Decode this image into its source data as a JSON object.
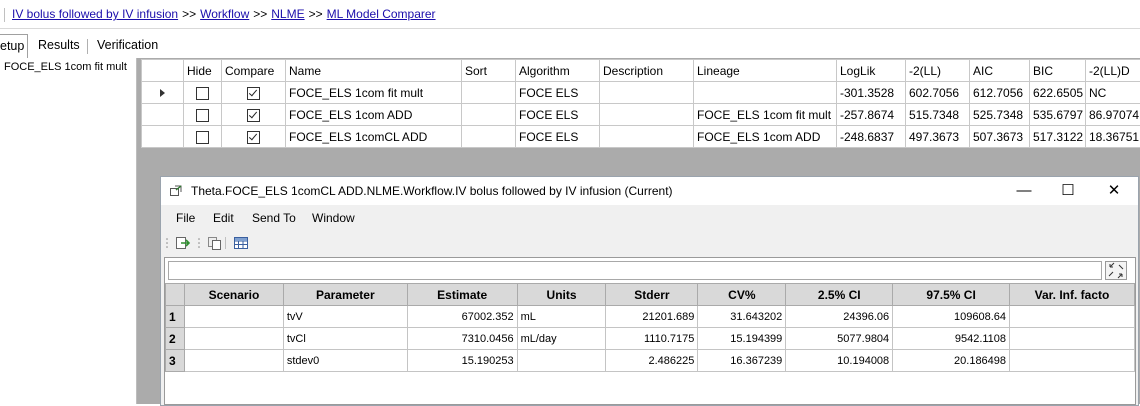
{
  "breadcrumbs": {
    "items": [
      "IV bolus followed by IV infusion",
      "Workflow",
      "NLME",
      "ML Model Comparer"
    ],
    "separator": ">>"
  },
  "tabs": [
    {
      "label": "etup"
    },
    {
      "label": "Results"
    },
    {
      "label": "Verification"
    }
  ],
  "left_pane": {
    "item": "FOCE_ELS 1com fit mult"
  },
  "model_table": {
    "columns": [
      "Hide",
      "Compare",
      "Name",
      "Sort",
      "Algorithm",
      "Description",
      "Lineage",
      "LogLik",
      "-2(LL)",
      "AIC",
      "BIC",
      "-2(LL)D"
    ],
    "rows": [
      {
        "current": true,
        "hide": false,
        "compare": true,
        "name": "FOCE_ELS 1com fit mult",
        "sort": "",
        "algorithm": "FOCE ELS",
        "description": "",
        "lineage": "",
        "loglik": "-301.3528",
        "m2ll": "602.7056",
        "aic": "612.7056",
        "bic": "622.6505",
        "m2lld": "NC"
      },
      {
        "current": false,
        "hide": false,
        "compare": true,
        "name": "FOCE_ELS 1com ADD",
        "sort": "",
        "algorithm": "FOCE ELS",
        "description": "",
        "lineage": "FOCE_ELS 1com fit mult",
        "loglik": "-257.8674",
        "m2ll": "515.7348",
        "aic": "525.7348",
        "bic": "535.6797",
        "m2lld": "86.97074"
      },
      {
        "current": false,
        "hide": false,
        "compare": true,
        "name": "FOCE_ELS 1comCL ADD",
        "sort": "",
        "algorithm": "FOCE ELS",
        "description": "",
        "lineage": "FOCE_ELS 1com ADD",
        "loglik": "-248.6837",
        "m2ll": "497.3673",
        "aic": "507.3673",
        "bic": "517.3122",
        "m2lld": "18.36751"
      }
    ]
  },
  "window": {
    "title": "Theta.FOCE_ELS 1comCL ADD.NLME.Workflow.IV bolus followed by IV infusion (Current)",
    "menu": [
      "File",
      "Edit",
      "Send To",
      "Window"
    ],
    "minimize": "—",
    "maximize": "☐",
    "close": "✕"
  },
  "theta_table": {
    "columns": [
      "Scenario",
      "Parameter",
      "Estimate",
      "Units",
      "Stderr",
      "CV%",
      "2.5% CI",
      "97.5% CI",
      "Var. Inf. facto"
    ],
    "rows": [
      {
        "n": "1",
        "scenario": "",
        "parameter": "tvV",
        "estimate": "67002.352",
        "units": "mL",
        "stderr": "21201.689",
        "cv": "31.643202",
        "ci_lo": "24396.06",
        "ci_hi": "109608.64",
        "vif": ""
      },
      {
        "n": "2",
        "scenario": "",
        "parameter": "tvCl",
        "estimate": "7310.0456",
        "units": "mL/day",
        "stderr": "1110.7175",
        "cv": "15.194399",
        "ci_lo": "5077.9804",
        "ci_hi": "9542.1108",
        "vif": ""
      },
      {
        "n": "3",
        "scenario": "",
        "parameter": "stdev0",
        "estimate": "15.190253",
        "units": "",
        "stderr": "2.486225",
        "cv": "16.367239",
        "ci_lo": "10.194008",
        "ci_hi": "20.186498",
        "vif": ""
      }
    ]
  }
}
